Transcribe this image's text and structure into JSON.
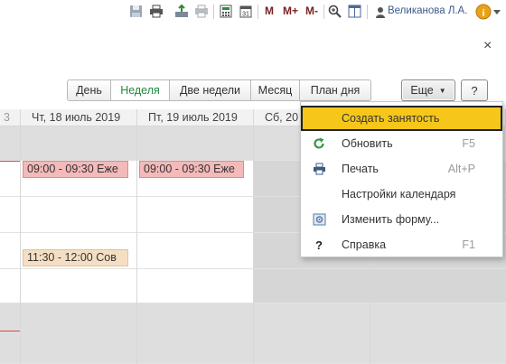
{
  "toolbar": {
    "m_label": "M",
    "m_plus_label": "M+",
    "m_minus_label": "M-",
    "user_name": "Великанова Л.А."
  },
  "views": {
    "day": "День",
    "week": "Неделя",
    "two_weeks": "Две недели",
    "month": "Месяц",
    "day_plan": "План дня",
    "active": "Неделя"
  },
  "more_label": "Еще",
  "help_label": "?",
  "close_label": "×",
  "calendar": {
    "headers": [
      "3",
      "Чт, 18 июль 2019",
      "Пт, 19 июль 2019",
      "Сб, 20"
    ],
    "events": [
      {
        "label": "09:00 - 09:30 Еже"
      },
      {
        "label": "09:00 - 09:30 Еже"
      },
      {
        "label": "11:30 - 12:00 Сов"
      }
    ]
  },
  "menu": {
    "items": [
      {
        "label": "Создать занятость",
        "shortcut": "",
        "icon": "none"
      },
      {
        "label": "Обновить",
        "shortcut": "F5",
        "icon": "refresh-icon"
      },
      {
        "label": "Печать",
        "shortcut": "Alt+P",
        "icon": "printer-icon"
      },
      {
        "label": "Настройки календаря",
        "shortcut": "",
        "icon": "none"
      },
      {
        "label": "Изменить форму...",
        "shortcut": "",
        "icon": "form-settings-icon"
      },
      {
        "label": "Справка",
        "shortcut": "F1",
        "icon": "help-icon"
      }
    ]
  },
  "colors": {
    "accent_active_view": "#1d8a3f",
    "menu_highlight": "#f6c71a",
    "event_pink": "#f4b9b9",
    "event_beige": "#f5dfc3"
  }
}
